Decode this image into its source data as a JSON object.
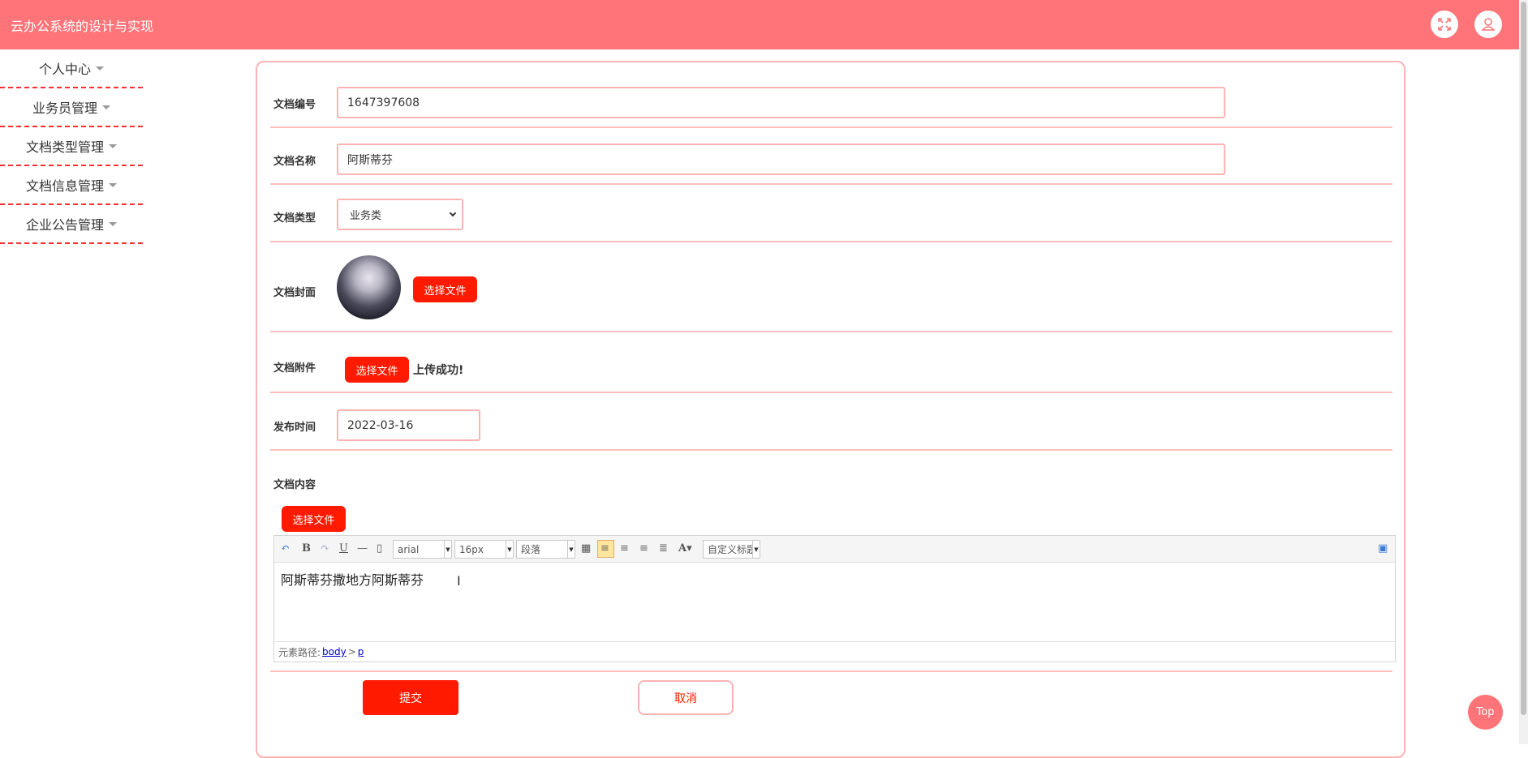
{
  "header": {
    "title": "云办公系统的设计与实现",
    "fullscreen_icon": "expand-icon",
    "user_icon": "user-icon"
  },
  "sidebar": {
    "items": [
      {
        "label": "个人中心"
      },
      {
        "label": "业务员管理"
      },
      {
        "label": "文档类型管理"
      },
      {
        "label": "文档信息管理"
      },
      {
        "label": "企业公告管理"
      }
    ]
  },
  "form": {
    "doc_number": {
      "label": "文档编号",
      "value": "1647397608"
    },
    "doc_name": {
      "label": "文档名称",
      "value": "阿斯蒂芬"
    },
    "doc_type": {
      "label": "文档类型",
      "selected": "业务类"
    },
    "doc_cover": {
      "label": "文档封面",
      "button": "选择文件"
    },
    "doc_attachment": {
      "label": "文档附件",
      "button": "选择文件",
      "status": "上传成功!"
    },
    "publish_time": {
      "label": "发布时间",
      "value": "2022-03-16"
    },
    "doc_content": {
      "label": "文档内容",
      "button": "选择文件",
      "toolbar": {
        "font_family": "arial",
        "font_size": "16px",
        "paragraph": "段落",
        "custom_title": "自定义标题"
      },
      "body_text": "阿斯蒂芬撒地方阿斯蒂芬",
      "path_label": "元素路径:",
      "path_body": "body",
      "path_sep": ">",
      "path_p": "p"
    }
  },
  "actions": {
    "submit": "提交",
    "cancel": "取消"
  },
  "back_to_top": "Top",
  "colors": {
    "header": "#ff7478",
    "primary": "#ff1a00",
    "border": "#ffb3b3"
  }
}
